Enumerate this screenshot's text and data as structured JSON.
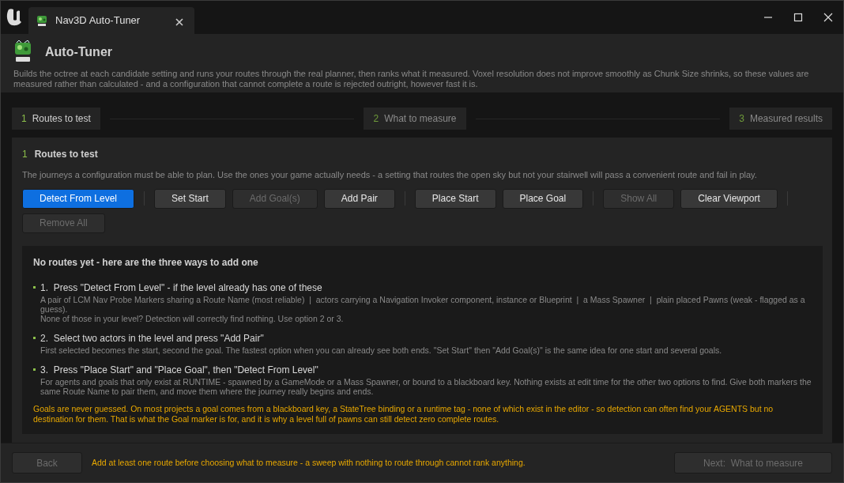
{
  "window": {
    "tab_title": "Nav3D Auto-Tuner"
  },
  "header": {
    "title": "Auto-Tuner",
    "description": "Builds the octree at each candidate setting and runs your routes through the real planner, then ranks what it measured. Voxel resolution does not improve smoothly as Chunk Size shrinks, so these values are measured rather than calculated - and a configuration that cannot complete a route is rejected outright, however fast it is."
  },
  "steps": [
    {
      "number": "1",
      "label": "Routes to test",
      "selected": true
    },
    {
      "number": "2",
      "label": "What to measure",
      "selected": false
    },
    {
      "number": "3",
      "label": "Measured results",
      "selected": false
    }
  ],
  "section": {
    "number": "1",
    "title": "Routes to test",
    "description": "The journeys a configuration must be able to plan. Use the ones your game actually needs - a setting that routes the open sky but not your stairwell will pass a convenient route and fail in play.",
    "button_groups": [
      [
        {
          "label": "Detect From Level",
          "kind": "primary",
          "disabled": false
        }
      ],
      [
        {
          "label": "Set Start",
          "kind": "normal",
          "disabled": false
        },
        {
          "label": "Add Goal(s)",
          "kind": "normal",
          "disabled": true
        },
        {
          "label": "Add Pair",
          "kind": "normal",
          "disabled": false
        }
      ],
      [
        {
          "label": "Place Start",
          "kind": "normal",
          "disabled": false
        },
        {
          "label": "Place Goal",
          "kind": "normal",
          "disabled": false
        }
      ],
      [
        {
          "label": "Show All",
          "kind": "normal",
          "disabled": true
        },
        {
          "label": "Clear Viewport",
          "kind": "normal",
          "disabled": false
        }
      ],
      [
        {
          "label": "Remove All",
          "kind": "normal",
          "disabled": true
        }
      ]
    ],
    "empty_state": {
      "title": "No routes yet - here are the three ways to add one",
      "options": [
        {
          "heading": "1.  Press \"Detect From Level\" - if the level already has one of these",
          "details": [
            "A pair of LCM Nav Probe Markers sharing a Route Name (most reliable)  |  actors carrying a Navigation Invoker component, instance or Blueprint  |  a Mass Spawner  |  plain placed Pawns (weak - flagged as a guess).",
            "None of those in your level? Detection will correctly find nothing. Use option 2 or 3."
          ]
        },
        {
          "heading": "2.  Select two actors in the level and press \"Add Pair\"",
          "details": [
            "First selected becomes the start, second the goal. The fastest option when you can already see both ends. \"Set Start\" then \"Add Goal(s)\" is the same idea for one start and several goals."
          ]
        },
        {
          "heading": "3.  Press \"Place Start\" and \"Place Goal\", then \"Detect From Level\"",
          "details": [
            "For agents and goals that only exist at RUNTIME - spawned by a GameMode or a Mass Spawner, or bound to a blackboard key. Nothing exists at edit time for the other two options to find. Give both markers the same Route Name to pair them, and move them where the journey really begins and ends."
          ]
        }
      ],
      "warning": "Goals are never guessed. On most projects a goal comes from a blackboard key, a StateTree binding or a runtime tag - none of which exist in the editor - so detection can often find your AGENTS but no destination for them. That is what the Goal marker is for, and it is why a level full of pawns can still detect zero complete routes."
    }
  },
  "footer": {
    "back": {
      "label": "Back",
      "disabled": true
    },
    "message": "Add at least one route before choosing what to measure - a sweep with nothing to route through cannot rank anything.",
    "next": {
      "label": "Next:  What to measure",
      "disabled": true
    }
  }
}
